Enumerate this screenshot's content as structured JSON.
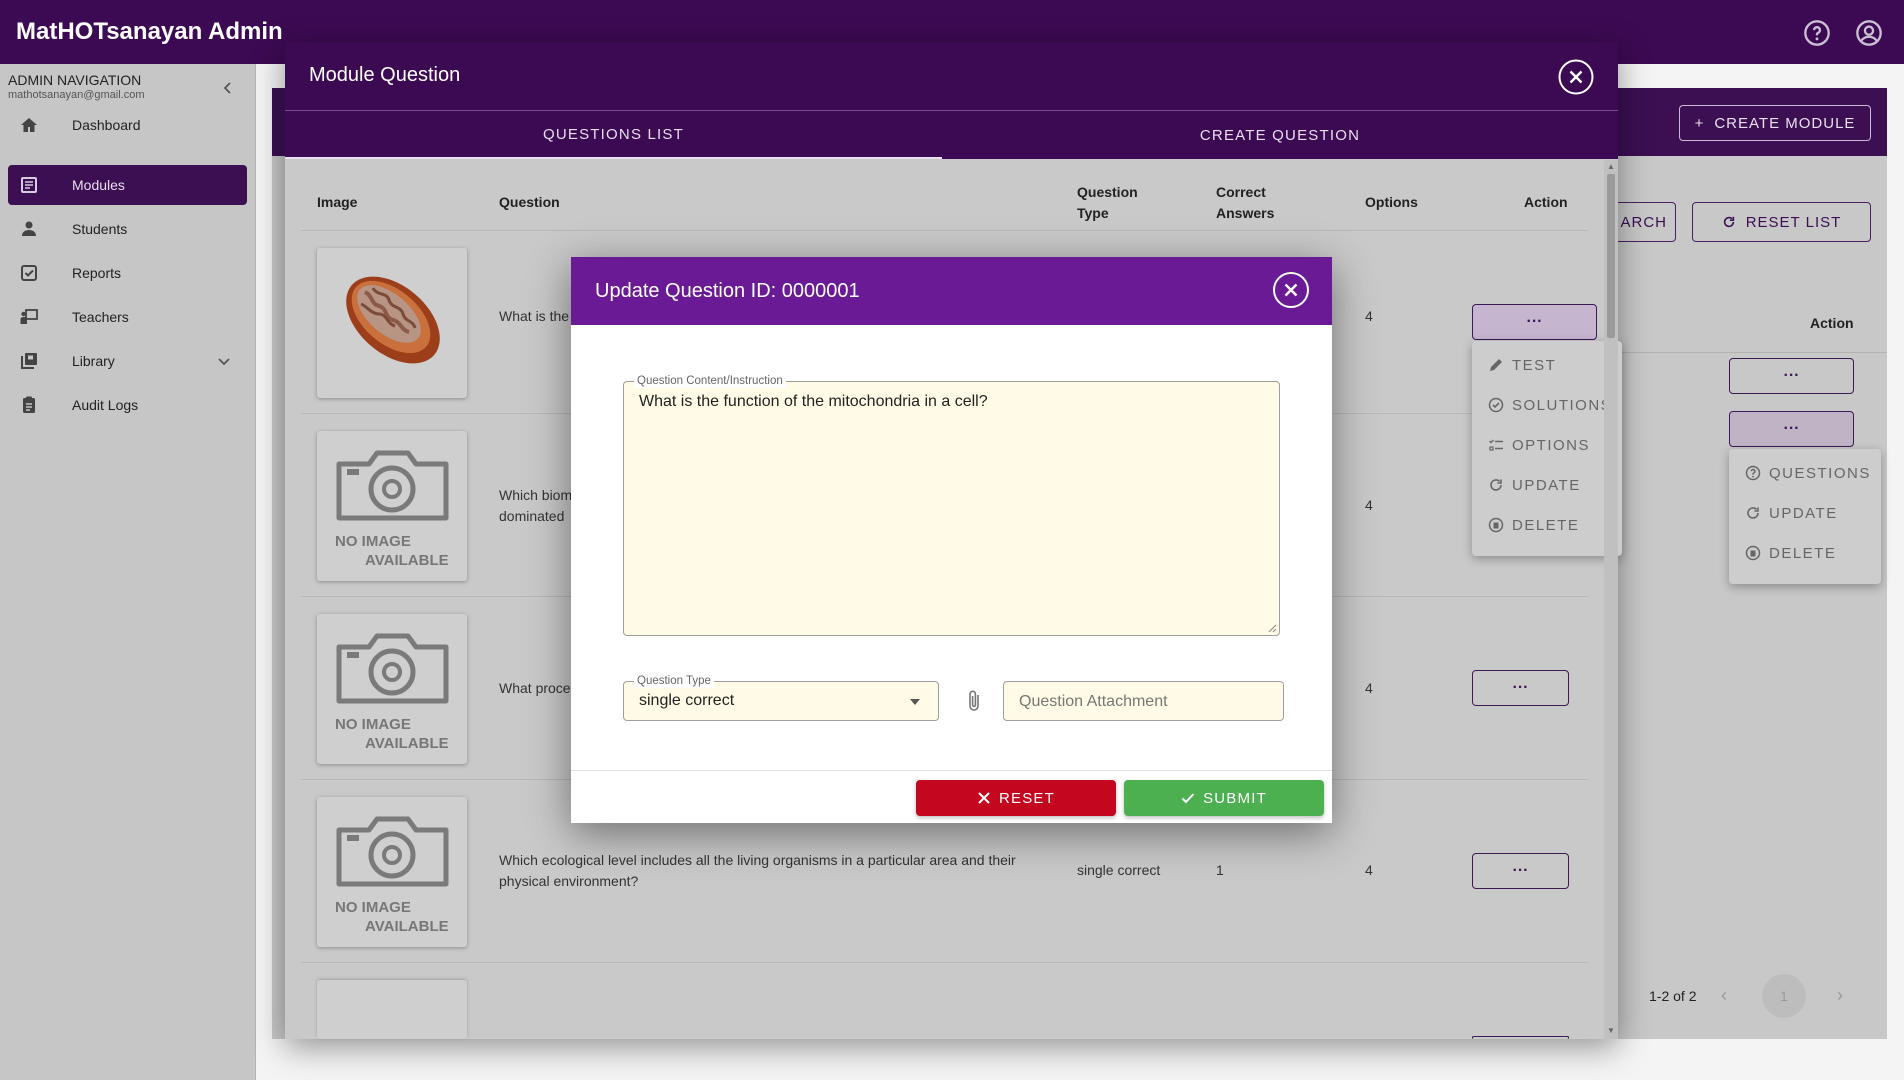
{
  "app": {
    "title": "MatHOTsanayan Admin"
  },
  "sidebar": {
    "title": "ADMIN NAVIGATION",
    "email": "mathotsanayan@gmail.com",
    "items": [
      {
        "label": "Dashboard",
        "icon": "home-icon"
      },
      {
        "label": "Modules",
        "icon": "modules-icon"
      },
      {
        "label": "Students",
        "icon": "student-icon"
      },
      {
        "label": "Reports",
        "icon": "reports-icon"
      },
      {
        "label": "Teachers",
        "icon": "teacher-icon"
      },
      {
        "label": "Library",
        "icon": "library-icon"
      },
      {
        "label": "Audit Logs",
        "icon": "audit-icon"
      }
    ]
  },
  "background_page": {
    "create_module_label": "CREATE MODULE",
    "search_label": "ARCH",
    "reset_list_label": "RESET LIST",
    "action_header": "Action",
    "row_action": "···",
    "menu": [
      "QUESTIONS",
      "UPDATE",
      "DELETE"
    ],
    "pagination": {
      "range": "1-2 of 2",
      "page": "1"
    }
  },
  "module_dialog": {
    "title": "Module Question",
    "tabs": [
      {
        "label": "QUESTIONS LIST"
      },
      {
        "label": "CREATE QUESTION"
      }
    ],
    "columns": {
      "image": "Image",
      "question": "Question",
      "question_type_1": "Question",
      "question_type_2": "Type",
      "correct_answers_1": "Correct",
      "correct_answers_2": "Answers",
      "options": "Options",
      "action": "Action"
    },
    "no_image_1": "NO IMAGE",
    "no_image_2": "AVAILABLE",
    "rows": [
      {
        "question": "What is the",
        "type": "",
        "correct": "",
        "options": "4",
        "action": "···"
      },
      {
        "question_1": "Which biom",
        "question_2": "dominated",
        "type": "",
        "correct": "",
        "options": "4"
      },
      {
        "question": "What proce",
        "type": "",
        "correct": "",
        "options": "4",
        "action": "···"
      },
      {
        "question_1": "Which ecological level includes all the living organisms in a particular area and their",
        "question_2": "physical environment?",
        "type": "single correct",
        "correct": "1",
        "options": "4",
        "action": "···"
      }
    ],
    "row_menu": [
      "TEST",
      "SOLUTIONS",
      "OPTIONS",
      "UPDATE",
      "DELETE"
    ]
  },
  "update_dialog": {
    "title": "Update Question ID: 0000001",
    "content_label": "Question Content/Instruction",
    "content_value": "What is the function of the mitochondria in a cell?",
    "type_label": "Question Type",
    "type_value": "single correct",
    "attachment_placeholder": "Question Attachment",
    "reset_label": "RESET",
    "submit_label": "SUBMIT"
  },
  "colors": {
    "primary": "#3c0a52",
    "dialog_header": "#6b1a95",
    "reset": "#c4061f",
    "submit": "#4caf50"
  }
}
